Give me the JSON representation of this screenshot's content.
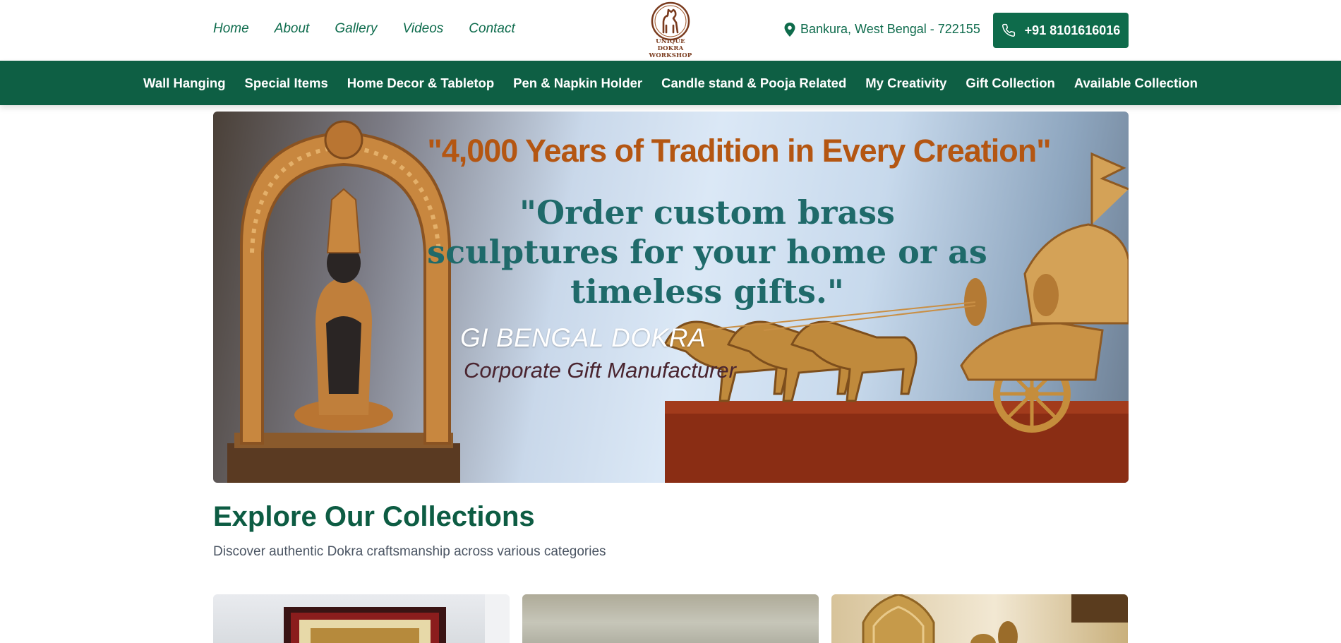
{
  "header": {
    "nav": [
      "Home",
      "About",
      "Gallery",
      "Videos",
      "Contact"
    ],
    "logo_text": [
      "UNIQUE DOKRA",
      "WORKSHOP"
    ],
    "location": "Bankura, West Bengal - 722155",
    "phone": "+91 8101616016"
  },
  "categories": [
    "Wall Hanging",
    "Special Items",
    "Home Decor & Tabletop",
    "Pen & Napkin Holder",
    "Candle stand & Pooja Related",
    "My Creativity",
    "Gift Collection",
    "Available Collection"
  ],
  "hero": {
    "headline": "\"4,000 Years of Tradition in Every Creation\"",
    "subline": "\"Order custom brass sculptures for your home or as timeless gifts.\"",
    "tag1": "GI BENGAL DOKRA",
    "tag2": "Corporate Gift Manufacturer"
  },
  "collections": {
    "title": "Explore Our Collections",
    "subtitle": "Discover authentic Dokra craftsmanship across various categories"
  },
  "colors": {
    "brand_green": "#0e6b4b",
    "nav_green": "#0e5f44",
    "headline_orange": "#b45612",
    "sub_teal": "#1f6a6a"
  },
  "icons": {
    "location": "map-pin-icon",
    "phone": "phone-icon",
    "logo": "horse-logo-icon"
  }
}
